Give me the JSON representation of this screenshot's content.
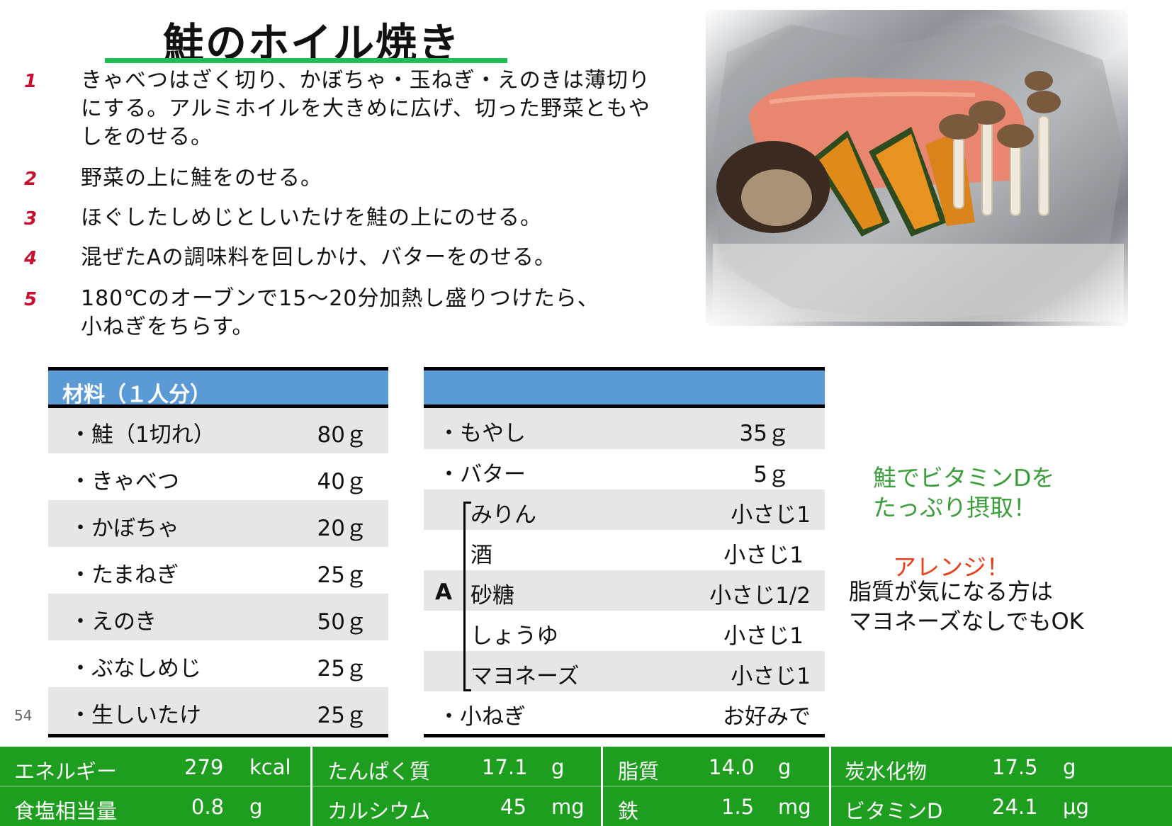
{
  "title": "鮭のホイル焼き",
  "steps": [
    {
      "num": "1",
      "text": "きゃべつはざく切り、かぼちゃ・玉ねぎ・えのきは薄切りにする。アルミホイルを大きめに広げ、切った野菜ともやしをのせる。"
    },
    {
      "num": "2",
      "text": "野菜の上に鮭をのせる。"
    },
    {
      "num": "3",
      "text": "ほぐしたしめじとしいたけを鮭の上にのせる。"
    },
    {
      "num": "4",
      "text": "混ぜたAの調味料を回しかけ、バターをのせる。"
    },
    {
      "num": "5",
      "text": "180℃のオーブンで15～20分加熱し盛りつけたら、小ねぎをちらす。"
    }
  ],
  "ingredients_header": "材料（１人分）",
  "ingredients_left": [
    {
      "name": "・鮭（1切れ）",
      "amount": "80ｇ"
    },
    {
      "name": "・きゃべつ",
      "amount": "40ｇ"
    },
    {
      "name": "・かぼちゃ",
      "amount": "20ｇ"
    },
    {
      "name": "・たまねぎ",
      "amount": "25ｇ"
    },
    {
      "name": "・えのき",
      "amount": "50ｇ"
    },
    {
      "name": "・ぶなしめじ",
      "amount": "25ｇ"
    },
    {
      "name": "・生しいたけ",
      "amount": "25ｇ"
    }
  ],
  "ingredients_right": [
    {
      "name": "・もやし",
      "amount": "35ｇ"
    },
    {
      "name": "・バター",
      "amount": "5ｇ"
    },
    {
      "name": "みりん",
      "amount": "小さじ1"
    },
    {
      "name": "酒",
      "amount": "小さじ1"
    },
    {
      "name": "砂糖",
      "amount": "小さじ1/2"
    },
    {
      "name": "しょうゆ",
      "amount": "小さじ1"
    },
    {
      "name": "マヨネーズ",
      "amount": "小さじ1"
    },
    {
      "name": "・小ねぎ",
      "amount": "お好みで"
    }
  ],
  "group_label": "A",
  "note_green": [
    "鮭でビタミンDを",
    "たっぷり摂取！"
  ],
  "arrange_title": "アレンジ！",
  "arrange_text": [
    "脂質が気になる方は",
    "マヨネーズなしでもOK"
  ],
  "page_number": "54",
  "nutrition": [
    {
      "label": "エネルギー",
      "value": "279",
      "unit": "kcal"
    },
    {
      "label": "たんぱく質",
      "value": "17.1",
      "unit": "g"
    },
    {
      "label": "脂質",
      "value": "14.0",
      "unit": "g"
    },
    {
      "label": "炭水化物",
      "value": "17.5",
      "unit": "g"
    },
    {
      "label": "食塩相当量",
      "value": "0.8",
      "unit": "g"
    },
    {
      "label": "カルシウム",
      "value": "45",
      "unit": "mg"
    },
    {
      "label": "鉄",
      "value": "1.5",
      "unit": "mg"
    },
    {
      "label": "ビタミンD",
      "value": "24.1",
      "unit": "μg"
    }
  ],
  "colors": {
    "accent_green": "#22bb55",
    "table_header": "#5b9bd5",
    "nutrition_bar": "#1e9e1e",
    "step_number": "#c8102e"
  }
}
